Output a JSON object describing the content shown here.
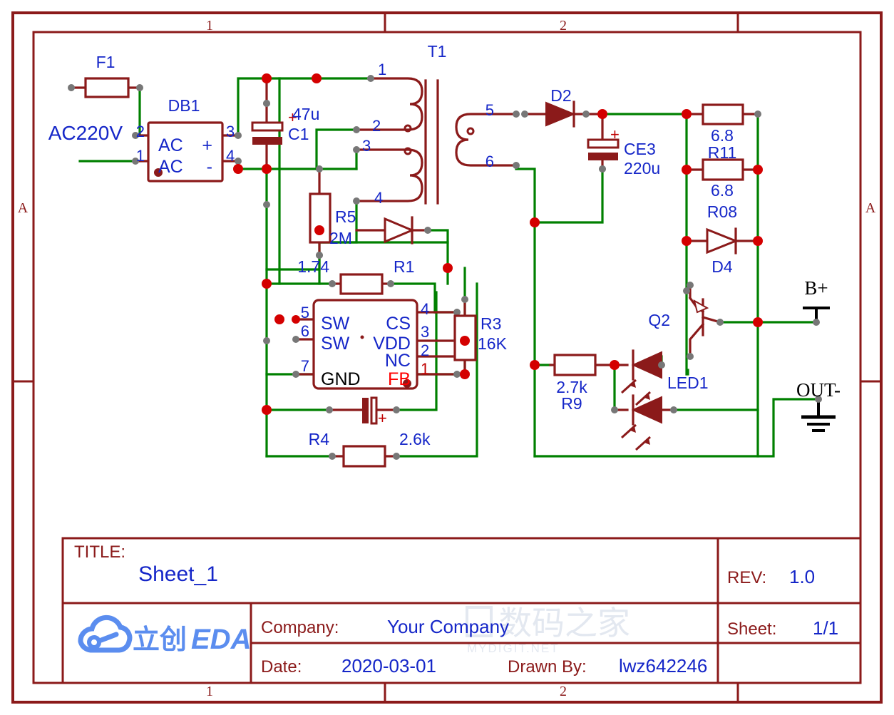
{
  "sheet": {
    "zone_top": [
      "1",
      "2"
    ],
    "zone_bottom": [
      "1",
      "2"
    ],
    "zone_left": "A",
    "zone_right": "A"
  },
  "net_labels": {
    "ac_input": "AC220V",
    "b_plus": "B+",
    "out_minus": "OUT-"
  },
  "components": {
    "f1": {
      "ref": "F1"
    },
    "db1": {
      "ref": "DB1",
      "pins": [
        {
          "num": "1",
          "name": "AC"
        },
        {
          "num": "2",
          "name": "AC"
        },
        {
          "num": "3",
          "name": "+"
        },
        {
          "num": "4",
          "name": "-"
        }
      ]
    },
    "c1": {
      "ref": "C1",
      "value": "47u",
      "polarity": "+"
    },
    "t1": {
      "ref": "T1",
      "pins": [
        "1",
        "2",
        "3",
        "4",
        "5",
        "6"
      ]
    },
    "r5": {
      "ref": "R5",
      "value": "2M"
    },
    "d1": {
      "ref": ""
    },
    "r1": {
      "ref": "R1",
      "value": "1.74"
    },
    "u1": {
      "pins": [
        {
          "num": "5",
          "name": "SW"
        },
        {
          "num": "6",
          "name": "SW"
        },
        {
          "num": "7",
          "name": "GND"
        },
        {
          "num": "4",
          "name": "CS"
        },
        {
          "num": "3",
          "name": "VDD"
        },
        {
          "num": "2",
          "name": "NC"
        },
        {
          "num": "1",
          "name": "FB"
        }
      ]
    },
    "r3": {
      "ref": "R3",
      "value": "16K"
    },
    "c2": {
      "ref": "",
      "polarity": "+"
    },
    "r4": {
      "ref": "R4",
      "value": "2.6k"
    },
    "d2": {
      "ref": "D2"
    },
    "ce3": {
      "ref": "CE3",
      "value": "220u",
      "polarity": "+"
    },
    "r11": {
      "ref": "R11",
      "value_top": "6.8",
      "value_bottom": "6.8"
    },
    "r08": {
      "ref": "R08"
    },
    "d4": {
      "ref": "D4"
    },
    "q2": {
      "ref": "Q2"
    },
    "r9": {
      "ref": "R9",
      "value": "2.7k"
    },
    "led1": {
      "ref": "LED1"
    }
  },
  "title_block": {
    "title_key": "TITLE:",
    "title_value": "Sheet_1",
    "rev_key": "REV:",
    "rev_value": "1.0",
    "company_key": "Company:",
    "company_value": "Your Company",
    "sheet_key": "Sheet:",
    "sheet_value": "1/1",
    "date_key": "Date:",
    "date_value": "2020-03-01",
    "drawn_key": "Drawn By:",
    "drawn_value": "lwz642246",
    "logo_cn": "立创",
    "logo_en": "EDA"
  },
  "watermark": {
    "line1": "数码之家",
    "line2": "MYDIGIT.NET"
  },
  "colors": {
    "wire_green": "#008000",
    "part_red": "#8B1A1A",
    "label_blue": "#1526C8",
    "junction": "#D40000",
    "pin_dot": "#777777"
  }
}
